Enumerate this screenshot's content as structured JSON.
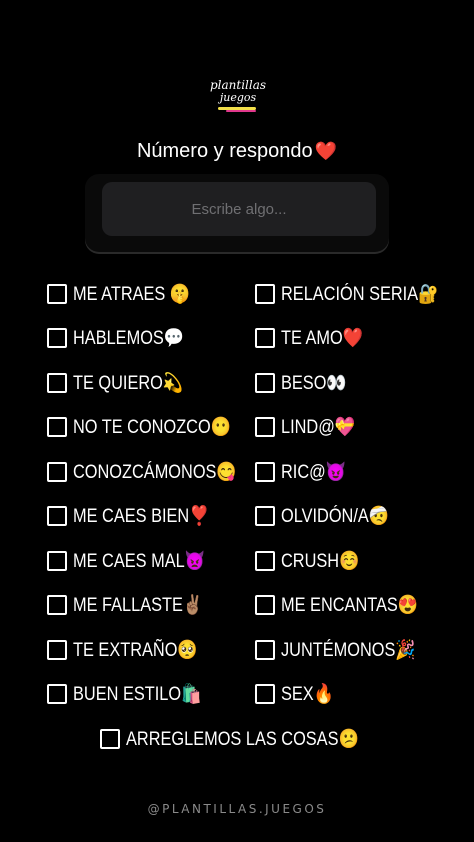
{
  "logo": {
    "line1": "plantillas",
    "line2": "juegos"
  },
  "title": {
    "text": "Número y respondo",
    "emoji": "❤️"
  },
  "input": {
    "placeholder": "Escribe algo..."
  },
  "left_items": [
    "ME ATRAES 🤫",
    "HABLEMOS💬",
    "TE QUIERO💫",
    "NO TE CONOZCO😶",
    "CONOZCÁMONOS😋",
    "ME CAES BIEN❣️",
    "ME CAES MAL👿",
    "ME FALLASTE✌🏽",
    "TE EXTRAÑO🥺",
    "BUEN ESTILO🛍️"
  ],
  "right_items": [
    "RELACIÓN SERIA🔐",
    "TE AMO❤️",
    "BESO👀",
    "LIND@💝",
    "RIC@😈",
    "OLVIDÓN/A🤕",
    "CRUSH☺️",
    "ME ENCANTAS😍",
    "JUNTÉMONOS🎉",
    "SEX🔥"
  ],
  "bottom_item": "ARREGLEMOS LAS COSAS😕",
  "footer": "@PLANTILLAS.JUEGOS"
}
